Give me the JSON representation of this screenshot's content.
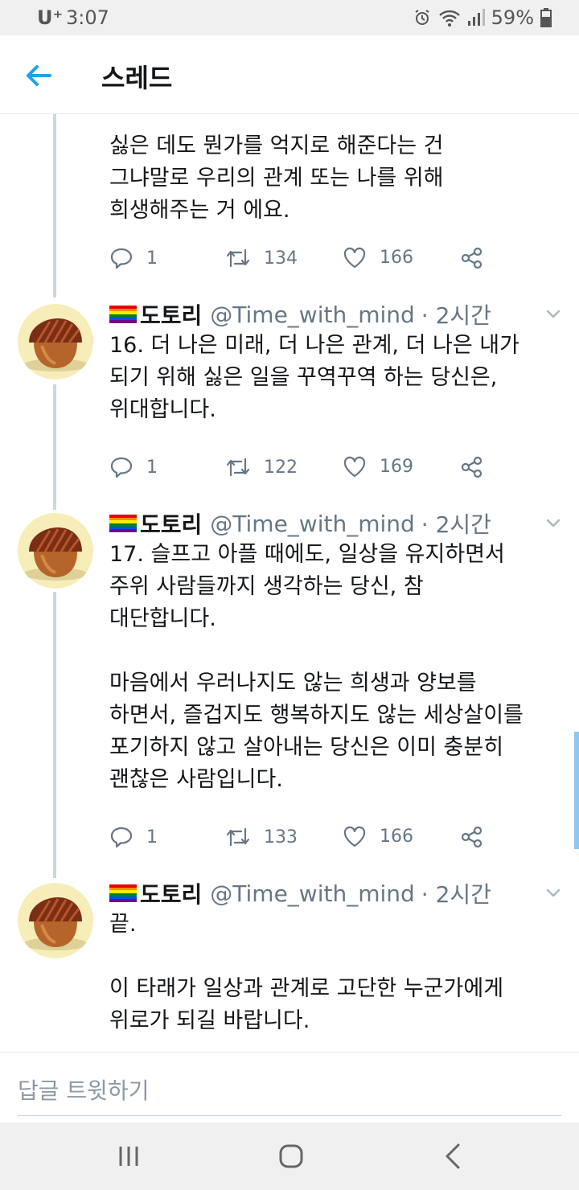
{
  "status": {
    "carrier": "U⁺",
    "time": "3:07",
    "battery": "59%"
  },
  "header": {
    "title": "스레드"
  },
  "tweets": [
    {
      "lines": [
        "싫은 데도 뭔가를 억지로 해준다는 건",
        "그냐말로 우리의 관계 또는 나를 위해",
        "희생해주는 거 에요."
      ],
      "replies": "1",
      "retweets": "134",
      "likes": "166"
    },
    {
      "name": "도토리",
      "handle": "@Time_with_mind",
      "time": "· 2시간",
      "lines": [
        "16. 더 나은 미래, 더 나은 관계, 더 나은 내가",
        "되기 위해 싫은 일을 꾸역꾸역 하는 당신은,",
        "위대합니다."
      ],
      "replies": "1",
      "retweets": "122",
      "likes": "169"
    },
    {
      "name": "도토리",
      "handle": "@Time_with_mind",
      "time": "· 2시간",
      "lines": [
        "17. 슬프고 아플 때에도, 일상을 유지하면서",
        "주위 사람들까지 생각하는 당신, 참",
        "대단합니다."
      ],
      "lines2": [
        "마음에서 우러나지도 않는 희생과 양보를",
        "하면서, 즐겁지도 행복하지도 않는 세상살이를",
        "포기하지 않고 살아내는 당신은 이미 충분히",
        "괜찮은 사람입니다."
      ],
      "replies": "1",
      "retweets": "133",
      "likes": "166"
    },
    {
      "name": "도토리",
      "handle": "@Time_with_mind",
      "time": "· 2시간",
      "lines": [
        "끝."
      ],
      "lines2": [
        "이 타래가 일상과 관계로 고단한 누군가에게",
        "위로가 되길 바랍니다."
      ]
    }
  ],
  "reply_bar": {
    "placeholder": "답글 트윗하기"
  },
  "colors": {
    "accent": "#1da1f2",
    "text": "#14171a",
    "secondary": "#657786",
    "thread_line": "#ccd6dd"
  },
  "icons": [
    "back-arrow-icon",
    "chevron-down-icon",
    "reply-icon",
    "retweet-icon",
    "like-icon",
    "share-icon",
    "recent-apps-icon",
    "home-icon",
    "back-icon"
  ]
}
